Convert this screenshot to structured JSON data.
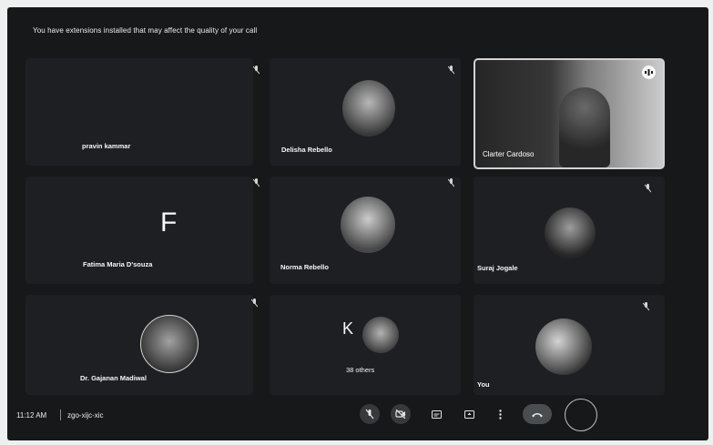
{
  "banner": "You have extensions installed that may affect the quality of your call",
  "participants": [
    {
      "name": "pravin kammar"
    },
    {
      "name": "Delisha Rebello"
    },
    {
      "name": "Clarter Cardoso"
    },
    {
      "name": "Fatima Maria D'souza",
      "initial": "F"
    },
    {
      "name": "Norma Rebello"
    },
    {
      "name": "Suraj Jogale"
    },
    {
      "name": "Dr. Gajanan Madiwal"
    },
    {
      "name": "38 others",
      "initial": "K"
    },
    {
      "name": "You"
    }
  ],
  "bottom_bar": {
    "time": "11:12 AM",
    "meeting_code": "zgo-xijc-xic"
  },
  "icons": {
    "mic_off": "mic-off-icon",
    "camera_off": "camera-off-icon",
    "captions": "captions-icon",
    "present": "present-screen-icon",
    "more": "more-options-icon",
    "end_call": "end-call-icon",
    "speaking": "speaking-indicator-icon"
  }
}
